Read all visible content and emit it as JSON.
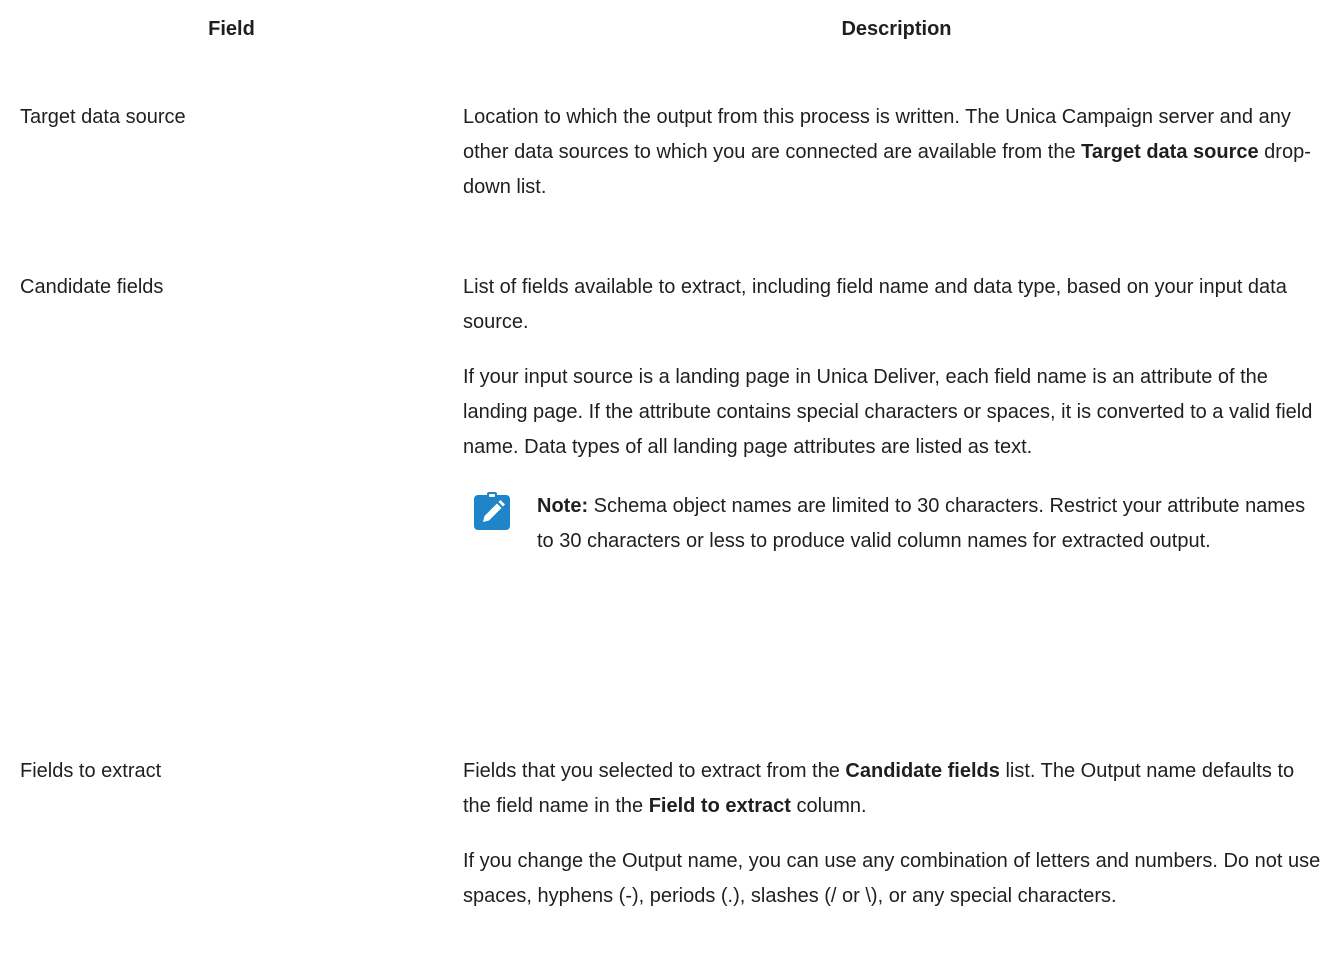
{
  "header": {
    "field": "Field",
    "description": "Description"
  },
  "rows": [
    {
      "field": "Target data source",
      "desc_p1_a": "Location to which the output from this process is written. The Unica Campaign server and any other data sources to which you are connected are available from the ",
      "desc_p1_b": "Target data source",
      "desc_p1_c": " drop-down list."
    },
    {
      "field": "Candidate fields",
      "desc_p1": "List of fields available to extract, including field name and data type, based on your input data source.",
      "desc_p2": "If your input source is a landing page in Unica Deliver, each field name is an attribute of the landing page. If the attribute contains special characters or spaces, it is converted to a valid field name. Data types of all landing page attributes are listed as text.",
      "note_label": "Note:",
      "note_text": " Schema object names are limited to 30 characters. Restrict your attribute names to 30 characters or less to produce valid column names for extracted output.",
      "note_icon": "pencil-icon",
      "note_icon_color": "#1e86c8"
    },
    {
      "field": "Fields to extract",
      "desc_p1_a": "Fields that you selected to extract from the ",
      "desc_p1_b": "Candidate fields",
      "desc_p1_c": " list. The Output name defaults to the field name in the ",
      "desc_p1_d": "Field to extract",
      "desc_p1_e": " column.",
      "desc_p2": "If you change the Output name, you can use any combination of letters and numbers. Do not use spaces, hyphens (-), periods (.), slashes (/ or \\), or any special characters."
    }
  ]
}
